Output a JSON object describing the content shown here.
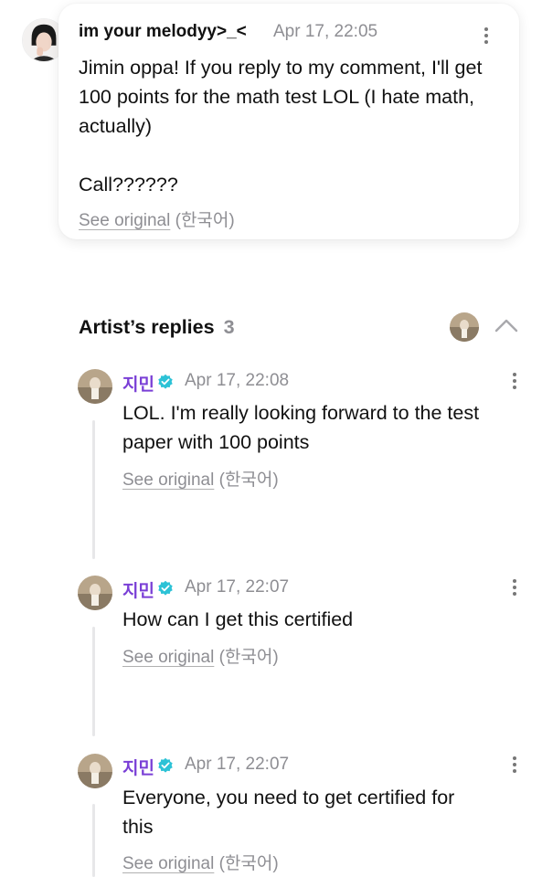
{
  "comment": {
    "author": "im your melodyy>_<",
    "time": "Apr 17, 22:05",
    "text": "Jimin oppa! If you reply to my comment, I'll get 100 points for the math test LOL (I hate math, actually)\n\nCall??????",
    "see_original": "See original",
    "language": "(한국어)"
  },
  "replies_header": {
    "title": "Artist’s replies",
    "count": "3"
  },
  "replies": [
    {
      "name": "지민",
      "time": "Apr 17, 22:08",
      "text": "LOL. I'm really looking forward to the test paper with 100 points",
      "see_original": "See original",
      "language": "(한국어)"
    },
    {
      "name": "지민",
      "time": "Apr 17, 22:07",
      "text": "How can I get this certified",
      "see_original": "See original",
      "language": "(한국어)"
    },
    {
      "name": "지민",
      "time": "Apr 17, 22:07",
      "text": "Everyone, you need to get certified for this",
      "see_original": "See original",
      "language": "(한국어)"
    }
  ],
  "colors": {
    "artist_name": "#7a3fd6",
    "verified_badge": "#2cc2d6",
    "muted_text": "#8e8e93"
  },
  "icons": {
    "more": "kebab-menu-icon",
    "collapse": "chevron-up-icon",
    "verified": "verified-badge-icon"
  }
}
